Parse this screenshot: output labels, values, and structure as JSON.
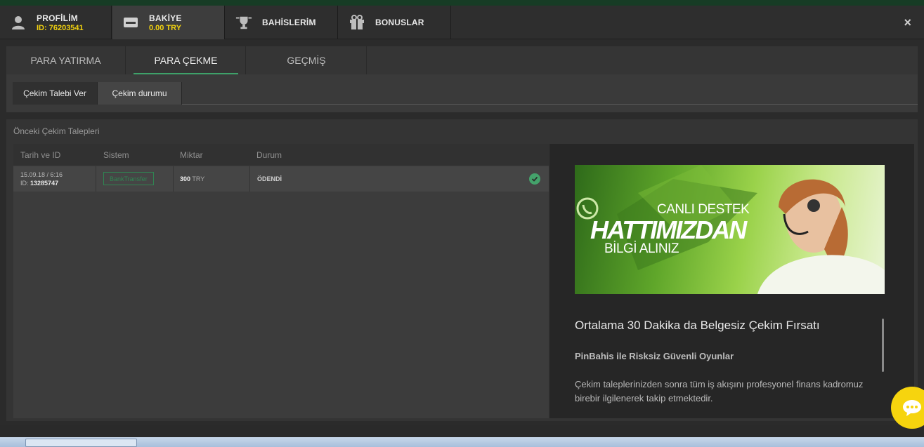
{
  "top_nav": {
    "profile_label": "PROFİLİM",
    "profile_id": "ID: 76203541",
    "balance_label": "BAKİYE",
    "balance_value": "0.00 TRY",
    "bets_label": "BAHİSLERİM",
    "bonus_label": "BONUSLAR",
    "close_glyph": "×"
  },
  "tabs": [
    {
      "label": "PARA YATIRMA",
      "active": false
    },
    {
      "label": "PARA ÇEKME",
      "active": true
    },
    {
      "label": "GEÇMİŞ",
      "active": false
    }
  ],
  "subtabs": [
    {
      "label": "Çekim Talebi Ver",
      "active": false
    },
    {
      "label": "Çekim durumu",
      "active": true
    }
  ],
  "section": {
    "title": "Önceki Çekim Talepleri",
    "columns": [
      "Tarih ve ID",
      "Sistem",
      "Miktar",
      "Durum"
    ],
    "rows": [
      {
        "date": "15.09.18 / 6:16",
        "id_prefix": "ID:",
        "id": "13285747",
        "system": "BankTransfer",
        "amount": "300",
        "currency": "TRY",
        "status": "ÖDENDİ"
      }
    ]
  },
  "promo": {
    "banner_line1": "CANLI DESTEK",
    "banner_line2": "HATTIMIZDAN",
    "banner_line3": "BİLGİ ALINIZ",
    "title": "Ortalama 30 Dakika da Belgesiz Çekim Fırsatı",
    "subtitle": "PinBahis ile Risksiz Güvenli Oyunlar",
    "text": "Çekim taleplerinizden sonra tüm iş akışını profesyonel finans kadromuz birebir ilgilenerek takip etmektedir."
  },
  "colors": {
    "accent_green": "#3ea169",
    "balance_yellow": "#f2d20f",
    "chat_yellow": "#f6d40e"
  },
  "icons": [
    "user-icon",
    "wallet-icon",
    "trophy-icon",
    "gift-icon",
    "close-icon",
    "check-icon",
    "chat-icon"
  ]
}
